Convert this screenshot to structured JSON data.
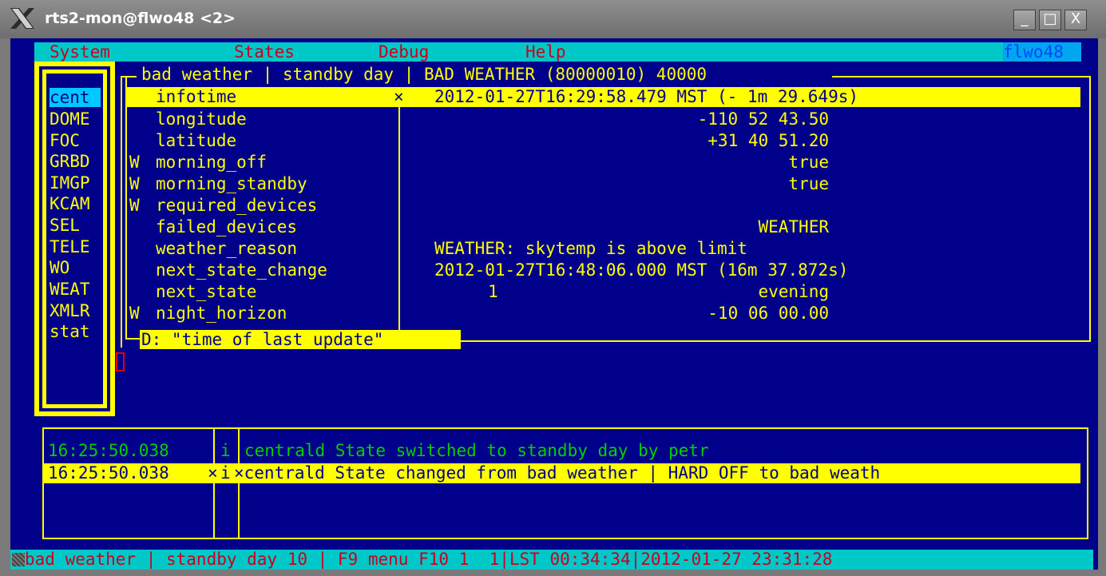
{
  "window": {
    "title": "rts2-mon@flwo48 <2>",
    "buttons": {
      "minimize": "_",
      "maximize": "□",
      "close": "X"
    }
  },
  "menubar": {
    "items": [
      "System",
      "States",
      "Debug",
      "Help"
    ],
    "host": "flwo48"
  },
  "devices": [
    "cent",
    "DOME",
    "FOC",
    "GRBD",
    "IMGP",
    "KCAM",
    "SEL",
    "TELE",
    "WO",
    "WEAT",
    "XMLR",
    "stat"
  ],
  "info": {
    "header": "bad weather | standby day | BAD WEATHER (80000010) 40000",
    "rows": [
      {
        "flag": "",
        "name": "infotime",
        "mark": "×",
        "value": "2012-01-27T16:29:58.479 MST (- 1m 29.649s)"
      },
      {
        "flag": "",
        "name": "longitude",
        "mark": "",
        "value": "-110 52 43.50"
      },
      {
        "flag": "",
        "name": "latitude",
        "mark": "",
        "value": "+31 40 51.20"
      },
      {
        "flag": "W",
        "name": "morning_off",
        "mark": "",
        "value": "true"
      },
      {
        "flag": "W",
        "name": "morning_standby",
        "mark": "",
        "value": "true"
      },
      {
        "flag": "W",
        "name": "required_devices",
        "mark": "",
        "value": ""
      },
      {
        "flag": "",
        "name": "failed_devices",
        "mark": "",
        "value": "WEATHER"
      },
      {
        "flag": "",
        "name": "weather_reason",
        "mark": "",
        "value": "WEATHER: skytemp is above limit"
      },
      {
        "flag": "",
        "name": "next_state_change",
        "mark": "",
        "value": "2012-01-27T16:48:06.000 MST (16m 37.872s)"
      },
      {
        "flag": "",
        "name": "next_state",
        "mark": "",
        "value": "evening",
        "extra": "1"
      },
      {
        "flag": "W",
        "name": "night_horizon",
        "mark": "",
        "value": "-10 06 00.00"
      }
    ],
    "description": "D: \"time of last update\""
  },
  "log": [
    {
      "time": "16:25:50.038",
      "mark": "",
      "type": "i",
      "message": "centrald State switched to standby day by petr"
    },
    {
      "time": "16:25:50.038",
      "mark": "×",
      "type": "i",
      "message": "×centrald State changed from bad weather | HARD OFF to bad weath"
    }
  ],
  "statusbar": {
    "text": "bad weather | standby day 10 | F9 menu F10 1  1|LST 00:34:34|2012-01-27 23:31:28"
  }
}
